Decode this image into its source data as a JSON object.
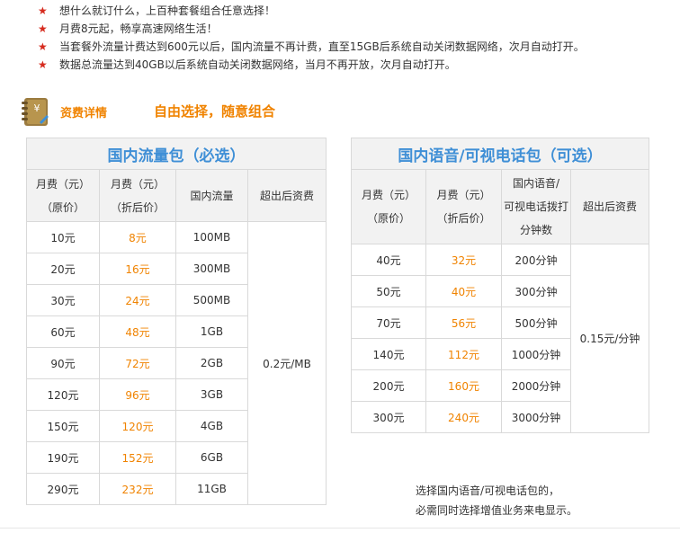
{
  "notes": [
    "想什么就订什么，上百种套餐组合任意选择！",
    "月费8元起，畅享高速网络生活！",
    "当套餐外流量计费达到600元以后，国内流量不再计费，直至15GB后系统自动关闭数据网络，次月自动打开。",
    "数据总流量达到40GB以后系统自动关闭数据网络，当月不再开放，次月自动打开。"
  ],
  "section": {
    "icon_symbol": "¥",
    "title": "资费详情",
    "slogan": "自由选择，随意组合"
  },
  "data_table": {
    "title": "国内流量包（必选）",
    "headers": {
      "orig_line1": "月费（元）",
      "orig_line2": "（原价）",
      "disc_line1": "月费（元）",
      "disc_line2": "（折后价）",
      "volume": "国内流量",
      "overage": "超出后资费"
    },
    "overage_value": "0.2元/MB",
    "rows": [
      {
        "orig": "10元",
        "disc": "8元",
        "volume": "100MB"
      },
      {
        "orig": "20元",
        "disc": "16元",
        "volume": "300MB"
      },
      {
        "orig": "30元",
        "disc": "24元",
        "volume": "500MB"
      },
      {
        "orig": "60元",
        "disc": "48元",
        "volume": "1GB"
      },
      {
        "orig": "90元",
        "disc": "72元",
        "volume": "2GB"
      },
      {
        "orig": "120元",
        "disc": "96元",
        "volume": "3GB"
      },
      {
        "orig": "150元",
        "disc": "120元",
        "volume": "4GB"
      },
      {
        "orig": "190元",
        "disc": "152元",
        "volume": "6GB"
      },
      {
        "orig": "290元",
        "disc": "232元",
        "volume": "11GB"
      }
    ]
  },
  "voice_table": {
    "title": "国内语音/可视电话包（可选）",
    "headers": {
      "orig_line1": "月费（元）",
      "orig_line2": "（原价）",
      "disc_line1": "月费（元）",
      "disc_line2": "（折后价）",
      "minutes_line1": "国内语音/",
      "minutes_line2": "可视电话拨打",
      "minutes_line3": "分钟数",
      "overage": "超出后资费"
    },
    "overage_value": "0.15元/分钟",
    "rows": [
      {
        "orig": "40元",
        "disc": "32元",
        "minutes": "200分钟"
      },
      {
        "orig": "50元",
        "disc": "40元",
        "minutes": "300分钟"
      },
      {
        "orig": "70元",
        "disc": "56元",
        "minutes": "500分钟"
      },
      {
        "orig": "140元",
        "disc": "112元",
        "minutes": "1000分钟"
      },
      {
        "orig": "200元",
        "disc": "160元",
        "minutes": "2000分钟"
      },
      {
        "orig": "300元",
        "disc": "240元",
        "minutes": "3000分钟"
      }
    ]
  },
  "footer": {
    "line1": "选择国内语音/可视电话包的，",
    "line2": "必需同时选择增值业务来电显示。"
  },
  "colors": {
    "star": "#d62b1e",
    "accent_orange": "#f08300",
    "title_blue": "#3f8fd6",
    "header_bg": "#f2f2f2",
    "border": "#d9d9d9"
  }
}
